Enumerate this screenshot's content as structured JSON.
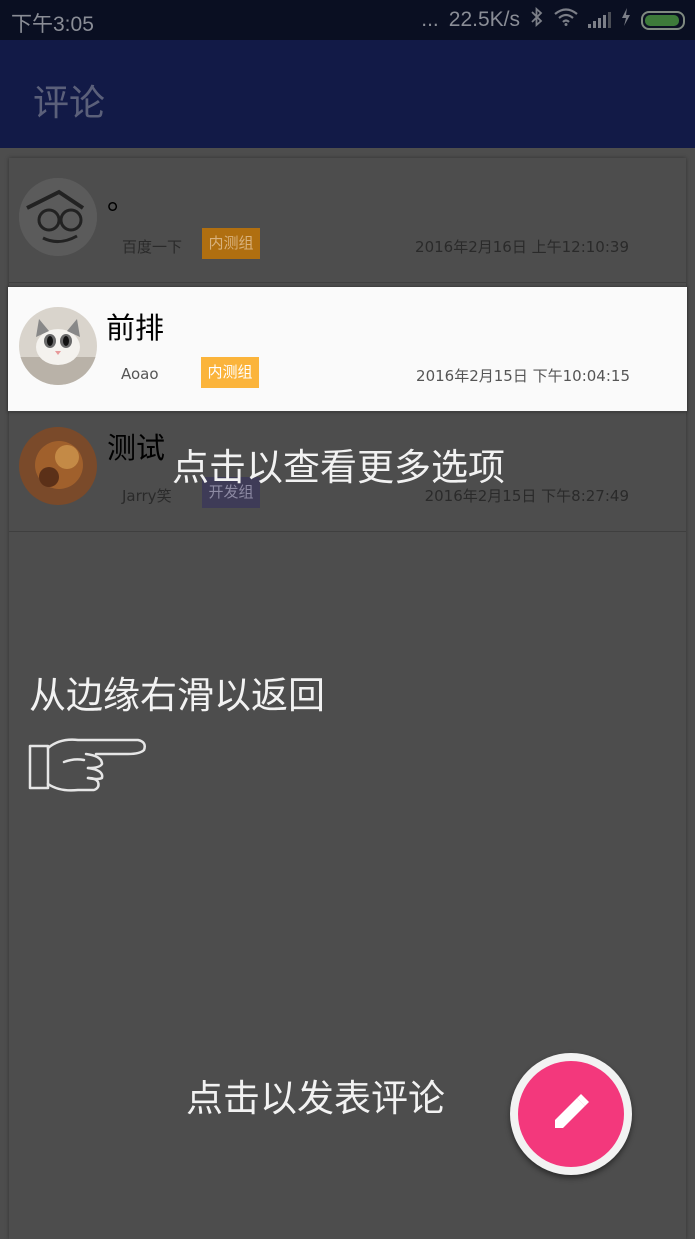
{
  "status_bar": {
    "time": "下午3:05",
    "dots": "...",
    "net_speed": "22.5K/s",
    "icons": [
      "bluetooth-icon",
      "wifi-icon",
      "signal-icon",
      "charging-icon",
      "battery-icon"
    ]
  },
  "app_bar": {
    "title": "评论"
  },
  "comments": [
    {
      "message": "。",
      "user": "百度一下",
      "tag": "内测组",
      "tag_color": "#b06f10",
      "time": "2016年2月16日 上午12:10:39"
    },
    {
      "message": "前排",
      "user": "Aoao",
      "tag": "内测组",
      "tag_color": "#fbb43b",
      "time": "2016年2月15日 下午10:04:15"
    },
    {
      "message": "测试",
      "user": "Jarry笑",
      "tag": "开发组",
      "tag_color": "#3e3b57",
      "time": "2016年2月15日 下午8:27:49"
    }
  ],
  "hints": {
    "more_options": "点击以查看更多选项",
    "swipe_back": "从边缘右滑以返回",
    "post_comment": "点击以发表评论"
  },
  "fab": {
    "icon": "pencil-icon",
    "color": "#f3387c"
  }
}
